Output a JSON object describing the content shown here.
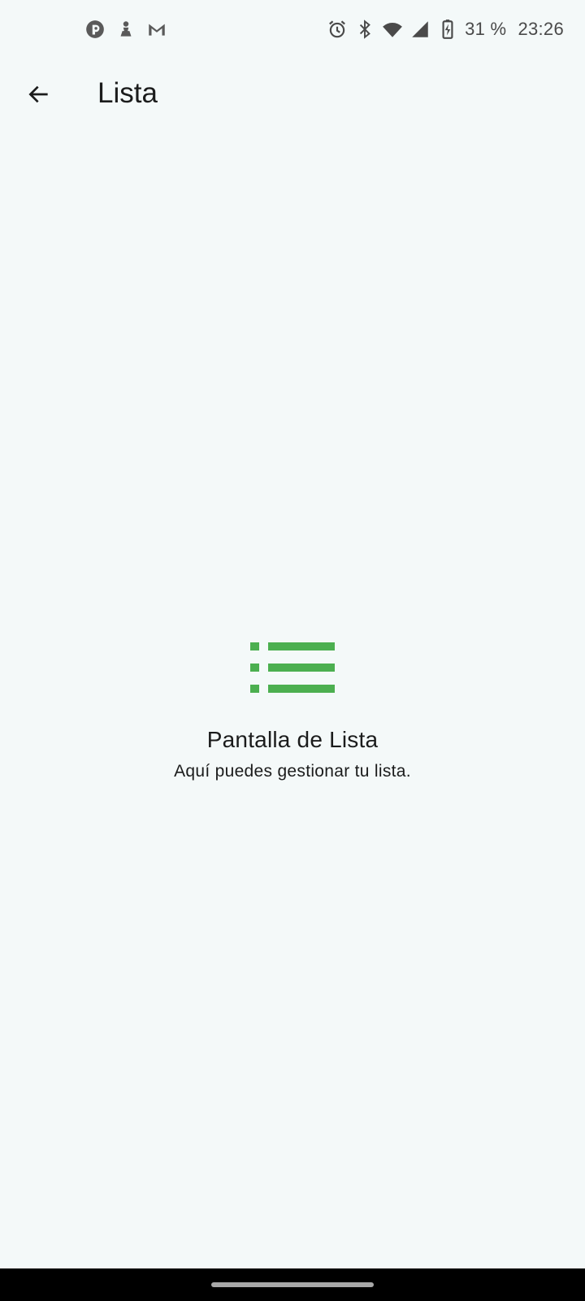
{
  "status_bar": {
    "left_icons": [
      "pocket-casts-icon",
      "chess-pawn-icon",
      "gmail-icon"
    ],
    "right_icons": [
      "alarm-icon",
      "bluetooth-icon",
      "wifi-icon",
      "signal-icon",
      "battery-charging-icon"
    ],
    "battery": "31 %",
    "time": "23:26"
  },
  "app_bar": {
    "back_icon": "arrow-back-icon",
    "title": "Lista"
  },
  "empty_state": {
    "icon": "list-icon",
    "title": "Pantalla de Lista",
    "subtitle": "Aquí puedes gestionar tu lista."
  },
  "colors": {
    "background": "#f4f9f9",
    "accent": "#4caf50",
    "text": "#1b1c1c",
    "status_icons": "#4a4a4a"
  }
}
